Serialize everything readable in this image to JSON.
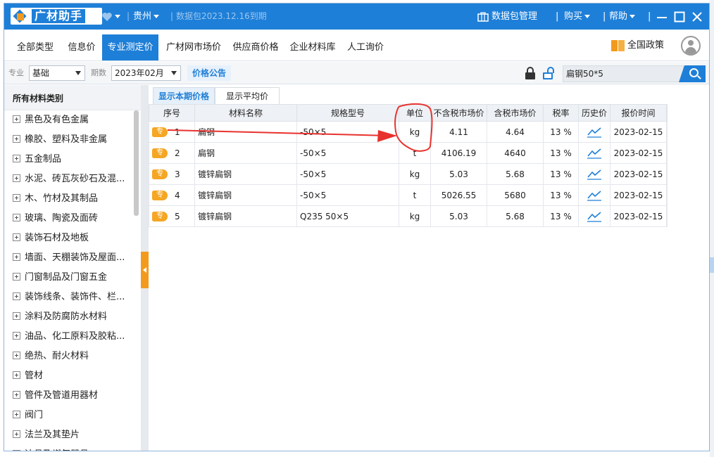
{
  "titlebar": {
    "logo_text": "广材助手",
    "region": "贵州",
    "package_expiry": "数据包2023.12.16到期",
    "data_mgmt": "数据包管理",
    "buy": "购买",
    "help": "帮助"
  },
  "nav": {
    "tabs": [
      {
        "label": "全部类型"
      },
      {
        "label": "信息价"
      },
      {
        "label": "专业测定价"
      },
      {
        "label": "广材网市场价"
      },
      {
        "label": "供应商价格"
      },
      {
        "label": "企业材料库"
      },
      {
        "label": "人工询价"
      }
    ],
    "active_tab": "专业测定价",
    "policy_label": "全国政策"
  },
  "filter": {
    "specialty_label": "专业",
    "specialty_value": "基础",
    "period_label": "期数",
    "period_value": "2023年02月",
    "price_notice": "价格公告",
    "search_value": "扁钢50*5"
  },
  "sidebar": {
    "header": "所有材料类别",
    "items": [
      {
        "label": "黑色及有色金属"
      },
      {
        "label": "橡胶、塑料及非金属"
      },
      {
        "label": "五金制品"
      },
      {
        "label": "水泥、砖瓦灰砂石及混..."
      },
      {
        "label": "木、竹材及其制品"
      },
      {
        "label": "玻璃、陶瓷及面砖"
      },
      {
        "label": "装饰石材及地板"
      },
      {
        "label": "墙面、天棚装饰及屋面..."
      },
      {
        "label": "门窗制品及门窗五金"
      },
      {
        "label": "装饰线条、装饰件、栏..."
      },
      {
        "label": "涂料及防腐防水材料"
      },
      {
        "label": "油品、化工原料及胶粘..."
      },
      {
        "label": "绝热、耐火材料"
      },
      {
        "label": "管材"
      },
      {
        "label": "管件及管道用器材"
      },
      {
        "label": "阀门"
      },
      {
        "label": "法兰及其垫片"
      },
      {
        "label": "洁具及燃气器具"
      }
    ]
  },
  "main": {
    "subtabs": [
      {
        "label": "显示本期价格"
      },
      {
        "label": "显示平均价"
      }
    ],
    "columns": [
      "序号",
      "材料名称",
      "规格型号",
      "单位",
      "不含税市场价",
      "含税市场价",
      "税率",
      "历史价",
      "报价时间"
    ],
    "tag_label": "专",
    "rows": [
      {
        "no": "1",
        "name": "扁钢",
        "spec": "-50×5",
        "unit": "kg",
        "price_ex": "4.11",
        "price_in": "4.64",
        "tax": "13 %",
        "date": "2023-02-15"
      },
      {
        "no": "2",
        "name": "扁钢",
        "spec": "-50×5",
        "unit": "t",
        "price_ex": "4106.19",
        "price_in": "4640",
        "tax": "13 %",
        "date": "2023-02-15"
      },
      {
        "no": "3",
        "name": "镀锌扁钢",
        "spec": "-50×5",
        "unit": "kg",
        "price_ex": "5.03",
        "price_in": "5.68",
        "tax": "13 %",
        "date": "2023-02-15"
      },
      {
        "no": "4",
        "name": "镀锌扁钢",
        "spec": "-50×5",
        "unit": "t",
        "price_ex": "5026.55",
        "price_in": "5680",
        "tax": "13 %",
        "date": "2023-02-15"
      },
      {
        "no": "5",
        "name": "镀锌扁钢",
        "spec": "Q235  50×5",
        "unit": "kg",
        "price_ex": "5.03",
        "price_in": "5.68",
        "tax": "13 %",
        "date": "2023-02-15"
      }
    ]
  },
  "annotation": {
    "color": "#e8322e"
  },
  "colors": {
    "brand": "#1e7fd8",
    "accent": "#f39a1e"
  }
}
